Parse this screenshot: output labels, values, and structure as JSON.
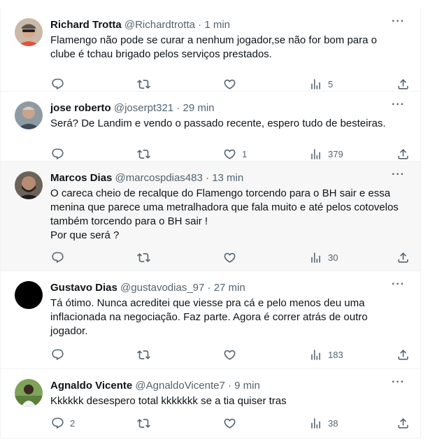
{
  "tweets": [
    {
      "name": "Richard Trotta",
      "handle": "@Richardtrotta",
      "time": "1 min",
      "lines": [
        "Flamengo não pode se curar a nenhum jogador,se não for bom para o",
        "clube é tchau brigado pelos serviços prestados."
      ],
      "replies": "",
      "retweets": "",
      "likes": "",
      "views": "5"
    },
    {
      "name": "jose roberto",
      "handle": "@joserpt321",
      "time": "29 min",
      "lines": [
        "Será? De Landim e vendo o passado recente, espero tudo de besteiras."
      ],
      "replies": "",
      "retweets": "",
      "likes": "1",
      "views": "379"
    },
    {
      "name": "Marcos Dias",
      "handle": "@marcospdias483",
      "time": "13 min",
      "lines": [
        "O careca cheio de recalque do Flamengo torcendo para o BH sair e essa",
        "menina que parece uma metralhadora que fala muito e até pelos cotovelos",
        "também torcendo para o BH sair !",
        "Por que será ?"
      ],
      "replies": "",
      "retweets": "",
      "likes": "",
      "views": "30"
    },
    {
      "name": "Gustavo Dias",
      "handle": "@gustavodias_97",
      "time": "27 min",
      "lines": [
        "Tá ótimo. Nunca acreditei que viesse pra cá e pelo menos deu uma",
        "inflacionada na negociação. Faz parte. Agora é correr atrás de outro",
        "jogador."
      ],
      "replies": "",
      "retweets": "",
      "likes": "",
      "views": "183"
    },
    {
      "name": "Agnaldo Vicente",
      "handle": "@AgnaldoVicente7",
      "time": "9 min",
      "lines": [
        "Kkkkkk desespero total kkkkkkk se a tia quiser tras"
      ],
      "replies": "2",
      "retweets": "",
      "likes": "",
      "views": "38"
    }
  ],
  "ui": {
    "separator": " · ",
    "more_glyph": "···"
  },
  "colors": {
    "text": "#0f1419",
    "secondary": "#536471",
    "border": "#eff3f4",
    "highlight_bg": "#f7f7f7"
  }
}
